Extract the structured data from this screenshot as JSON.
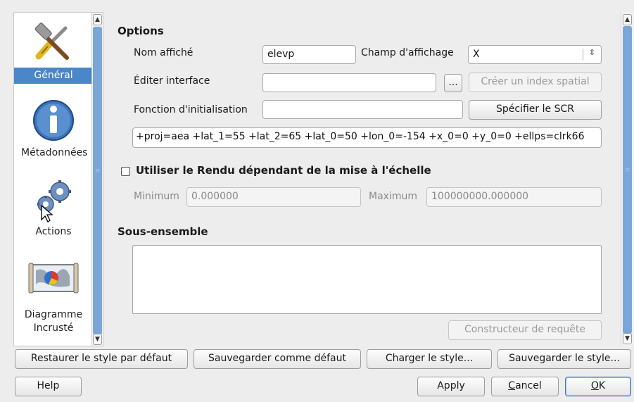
{
  "sidebar": {
    "items": [
      {
        "label": "Général",
        "icon": "tools-icon",
        "selected": true
      },
      {
        "label": "Métadonnées",
        "icon": "info-icon",
        "selected": false
      },
      {
        "label": "Actions",
        "icon": "gears-icon",
        "selected": false
      },
      {
        "label": "Diagramme\nIncrusté",
        "icon": "diagram-icon",
        "selected": false
      }
    ]
  },
  "options": {
    "title": "Options",
    "display_name_label": "Nom affiché",
    "display_name_value": "elevp",
    "display_field_label": "Champ d'affichage",
    "display_field_value": "X",
    "edit_interface_label": "Éditer interface",
    "edit_interface_value": "",
    "browse_label": "...",
    "spatial_index_label": "Créer un index spatial",
    "init_function_label": "Fonction d'initialisation",
    "init_function_value": "",
    "specify_crs_label": "Spécifier le SCR",
    "crs_string": "+proj=aea +lat_1=55 +lat_2=65 +lat_0=50 +lon_0=-154 +x_0=0 +y_0=0 +ellps=clrk66"
  },
  "scale": {
    "checkbox_label": "Utiliser le Rendu dépendant de la mise à l'échelle",
    "checked": false,
    "minimum_label": "Minimum",
    "minimum_value": "0.000000",
    "maximum_label": "Maximum",
    "maximum_value": "100000000.000000"
  },
  "subset": {
    "title": "Sous-ensemble",
    "value": "",
    "query_builder_label": "Constructeur de requête"
  },
  "style_buttons": {
    "restore": "Restaurer le style par défaut",
    "save_default": "Sauvegarder comme défaut",
    "load": "Charger le style...",
    "save": "Sauvegarder le style..."
  },
  "dialog_buttons": {
    "help": "Help",
    "apply": "Apply",
    "cancel_prefix": "C",
    "cancel_rest": "ancel",
    "ok_prefix": "O",
    "ok_rest": "K"
  },
  "colors": {
    "selection": "#4a86c8",
    "scroll_thumb": "#7aa6da"
  }
}
